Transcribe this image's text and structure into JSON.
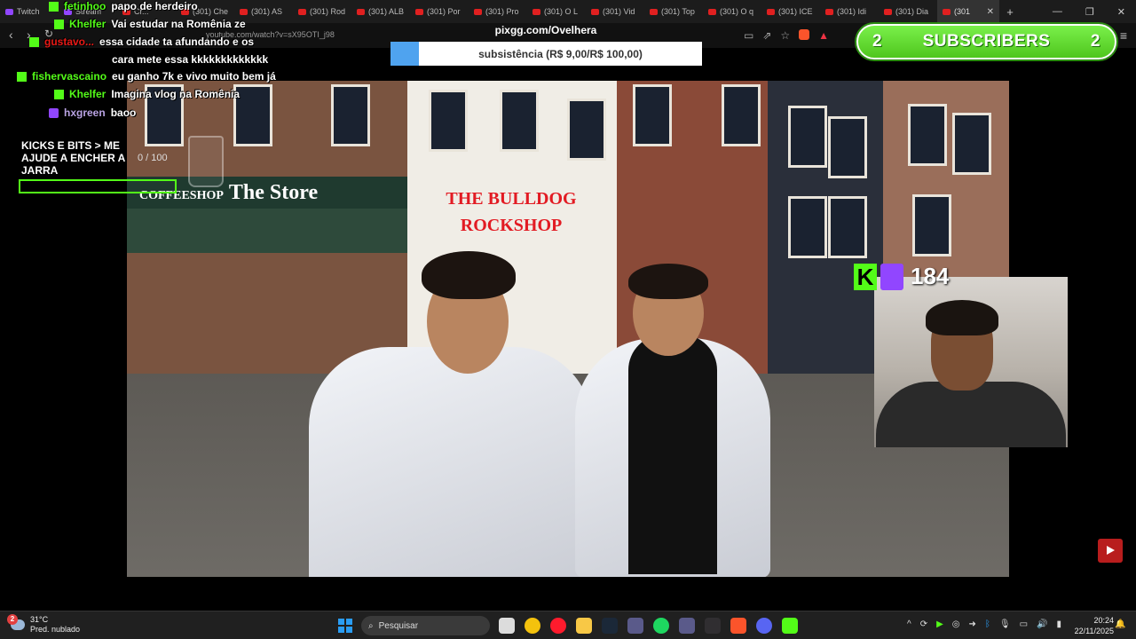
{
  "browser": {
    "tabs": [
      {
        "label": "Twitch",
        "kind": "twitch"
      },
      {
        "label": "Stream",
        "kind": "twitch"
      },
      {
        "label": "Cr...",
        "kind": "yt"
      },
      {
        "label": "(301) Che",
        "kind": "yt"
      },
      {
        "label": "(301) AS",
        "kind": "yt"
      },
      {
        "label": "(301) Rod",
        "kind": "yt"
      },
      {
        "label": "(301) ALB",
        "kind": "yt"
      },
      {
        "label": "(301) Por",
        "kind": "yt"
      },
      {
        "label": "(301) Pro",
        "kind": "yt"
      },
      {
        "label": "(301) O L",
        "kind": "yt"
      },
      {
        "label": "(301) Vid",
        "kind": "yt"
      },
      {
        "label": "(301) Top",
        "kind": "yt"
      },
      {
        "label": "(301) O q",
        "kind": "yt"
      },
      {
        "label": "(301) ICE",
        "kind": "yt"
      },
      {
        "label": "(301) Idi",
        "kind": "yt"
      },
      {
        "label": "(301) Dia",
        "kind": "yt"
      },
      {
        "label": "(301",
        "kind": "yt",
        "active": true
      }
    ],
    "url": "youtube.com/watch?v=sX95OTI_j98"
  },
  "chat": [
    {
      "badge": "kick",
      "user": "fetinhoo",
      "message": "papo de herdeiro"
    },
    {
      "badge": "kick",
      "user": "Khelfer",
      "message": "Vai estudar na Romênia ze"
    },
    {
      "badge": "kick",
      "user": "gustavo...",
      "user_color": "red",
      "message": "essa cidade ta afundando e os"
    },
    {
      "badge": "",
      "user": "",
      "message": "cara mete essa kkkkkkkkkkkkk"
    },
    {
      "badge": "kick",
      "user": "fishervascaino",
      "message": "eu ganho 7k e vivo muito bem já"
    },
    {
      "badge": "kick",
      "user": "Khelfer",
      "message": "Imagina vlog na Romênia"
    },
    {
      "badge": "twitch",
      "user": "hxgreen",
      "message": "baoo"
    }
  ],
  "goal": {
    "title": "KICKS E BITS > ME AJUDE A ENCHER A JARRA",
    "count": "0 / 100",
    "progress": 0
  },
  "donation": {
    "pix_url": "pixgg.com/Ovelhera",
    "label": "subsistência (R$ 9,00/R$ 100,00)",
    "progress": 0.09
  },
  "subscribers": {
    "left": "2",
    "label": "SUBSCRIBERS",
    "right": "2"
  },
  "viewers": {
    "count": "184"
  },
  "video": {
    "sign_store": "The Store",
    "sign_store_prefix": "COFFEESHOP",
    "sign_bulldog": "THE BULLDOG ROCKSHOP"
  },
  "taskbar": {
    "weather_temp": "31°C",
    "weather_desc": "Pred. nublado",
    "weather_badge": "2",
    "search_placeholder": "Pesquisar",
    "time": "20:24",
    "date": "22/11/2025",
    "apps": [
      "file-explorer",
      "chrome",
      "opera",
      "folder",
      "steam",
      "app",
      "spotify",
      "app",
      "obs",
      "brave",
      "discord",
      "kick"
    ]
  }
}
